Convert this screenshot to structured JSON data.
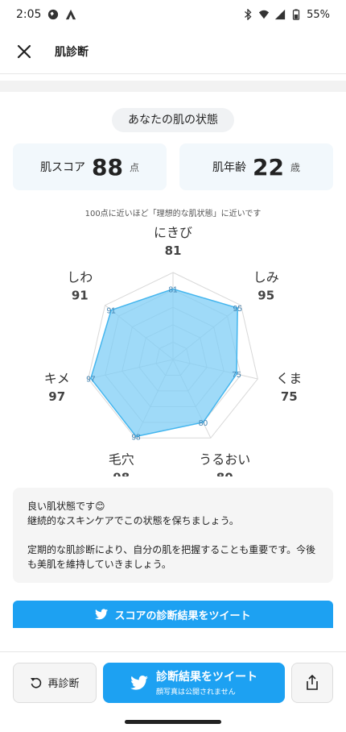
{
  "status_bar": {
    "time": "2:05",
    "battery": "55%"
  },
  "header": {
    "title": "肌診断"
  },
  "section_title": "あなたの肌の状態",
  "score_card": {
    "label": "肌スコア",
    "value": "88",
    "unit": "点"
  },
  "age_card": {
    "label": "肌年齢",
    "value": "22",
    "unit": "歳"
  },
  "note": "100点に近いほど「理想的な肌状態」に近いです",
  "chart_data": {
    "type": "radar",
    "categories": [
      "にきび",
      "しみ",
      "くま",
      "うるおい",
      "毛穴",
      "キメ",
      "しわ"
    ],
    "values": [
      81,
      95,
      75,
      80,
      98,
      97,
      91
    ],
    "range": [
      0,
      100
    ],
    "fill_color": "#7fcdf5",
    "stroke_color": "#45b6ee"
  },
  "message": {
    "line1": "良い肌状態です😊",
    "line2": "継続的なスキンケアでこの状態を保ちましょう。",
    "line3": "定期的な肌診断により、自分の肌を把握することも重要です。今後も美肌を維持していきましょう。"
  },
  "tweet_banner": "スコアの診断結果をツイート",
  "bottom": {
    "rediagnose_label": "再診断",
    "tweet_label": "診断結果をツイート",
    "tweet_sub": "顔写真は公開されません"
  },
  "colors": {
    "accent": "#1da1f2"
  }
}
